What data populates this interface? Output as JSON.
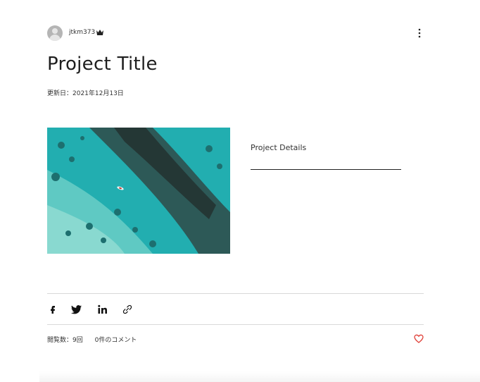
{
  "author": {
    "name": "jtkm373"
  },
  "post": {
    "title": "Project Title",
    "updated": "更新日：2021年12月13日",
    "details_label": "Project Details",
    "image_alt": "aerial view of turquoise reef"
  },
  "stats": {
    "views": "閲覧数：9回",
    "comments": "0件のコメント"
  },
  "share": [
    "facebook-icon",
    "twitter-icon",
    "linkedin-icon",
    "link-icon"
  ],
  "colors": {
    "like": "#e0423a",
    "reef_water": "#25b3b5",
    "reef_sand": "#7fd6cf",
    "reef_rock": "#2b3d3c"
  }
}
